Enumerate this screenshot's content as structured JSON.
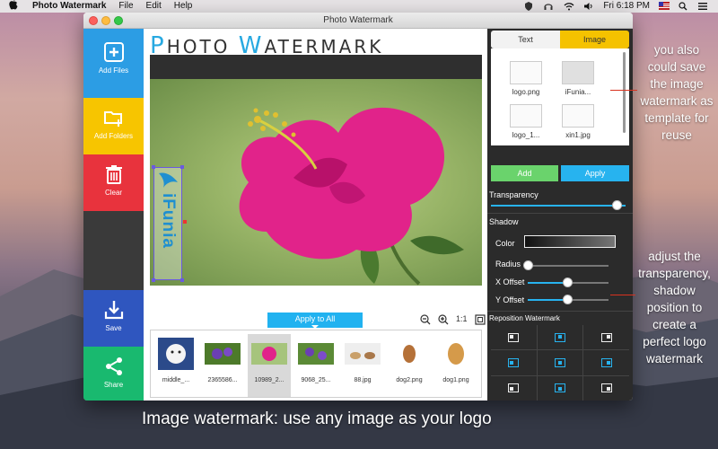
{
  "menubar": {
    "app_name": "Photo Watermark",
    "items": [
      "File",
      "Edit",
      "Help"
    ],
    "clock": "Fri 6:18 PM"
  },
  "window": {
    "title": "Photo Watermark",
    "app_title_cap1": "P",
    "app_title_rest1": "HOTO ",
    "app_title_cap2": "W",
    "app_title_rest2": "ATERMARK"
  },
  "sidebar": {
    "add_files": "Add Files",
    "add_folders": "Add Folders",
    "clear": "Clear",
    "save": "Save",
    "share": "Share"
  },
  "preview": {
    "watermark_text": "iFunia"
  },
  "toolbar": {
    "apply_to_all": "Apply to All",
    "actual_size": "1:1"
  },
  "thumbnails": [
    {
      "name": "middle_..."
    },
    {
      "name": "2365586..."
    },
    {
      "name": "10989_2...",
      "selected": true
    },
    {
      "name": "9068_25..."
    },
    {
      "name": "88.jpg"
    },
    {
      "name": "dog2.png"
    },
    {
      "name": "dog1.png"
    }
  ],
  "right_panel": {
    "tab_text": "Text",
    "tab_image": "Image",
    "library": [
      {
        "name": "logo.png"
      },
      {
        "name": "iFunia...",
        "selected": true
      },
      {
        "name": "logo_1..."
      },
      {
        "name": "xin1.jpg"
      }
    ],
    "add_label": "Add",
    "apply_label": "Apply",
    "transparency_label": "Transparency",
    "transparency_value": 1.0,
    "shadow_label": "Shadow",
    "color_label": "Color",
    "radius_label": "Radius",
    "radius_value": 0.0,
    "x_offset_label": "X Offset",
    "x_offset_value": 0.5,
    "y_offset_label": "Y Offset",
    "y_offset_value": 0.5,
    "reposition_label": "Reposition Watermark"
  },
  "annotations": {
    "top_right": "you also could save the image watermark as template for reuse",
    "middle_right": "adjust the transparency, shadow position to create a perfect logo watermark",
    "caption": "Image watermark: use any image as your logo"
  },
  "colors": {
    "accent_blue": "#27b3ef",
    "add_green": "#6ad36c",
    "tab_yellow": "#f5c200"
  }
}
